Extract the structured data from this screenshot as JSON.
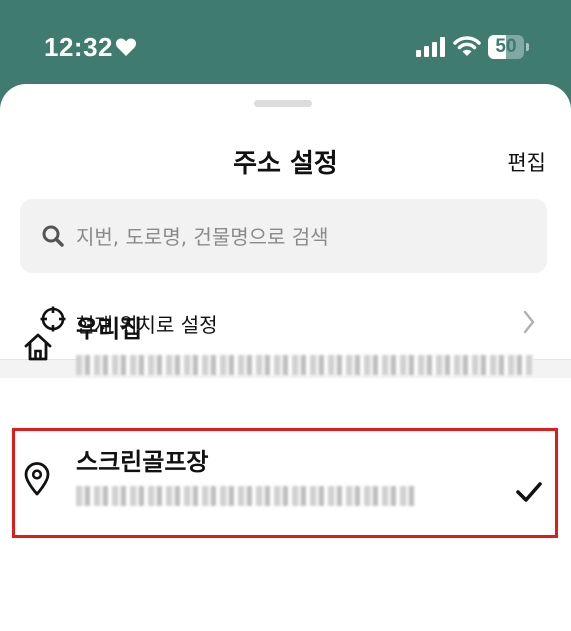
{
  "status_bar": {
    "time": "12:32",
    "battery_level": "50",
    "battery_fraction": 0.5,
    "icons": [
      "heart-icon",
      "cellular-signal-icon",
      "wifi-icon",
      "battery-icon"
    ]
  },
  "sheet": {
    "title": "주소 설정",
    "edit_label": "편집"
  },
  "search": {
    "placeholder": "지번, 도로명, 건물명으로 검색",
    "value": ""
  },
  "current_location": {
    "label": "현재 위치로 설정",
    "icon": "crosshair-icon"
  },
  "addresses": [
    {
      "name": "우리집",
      "icon": "home-icon",
      "selected": false
    },
    {
      "name": "스크린골프장",
      "icon": "location-pin-icon",
      "selected": true
    }
  ],
  "colors": {
    "status_bar_bg": "#3f7b6f",
    "highlight_border": "#e01b1b"
  }
}
